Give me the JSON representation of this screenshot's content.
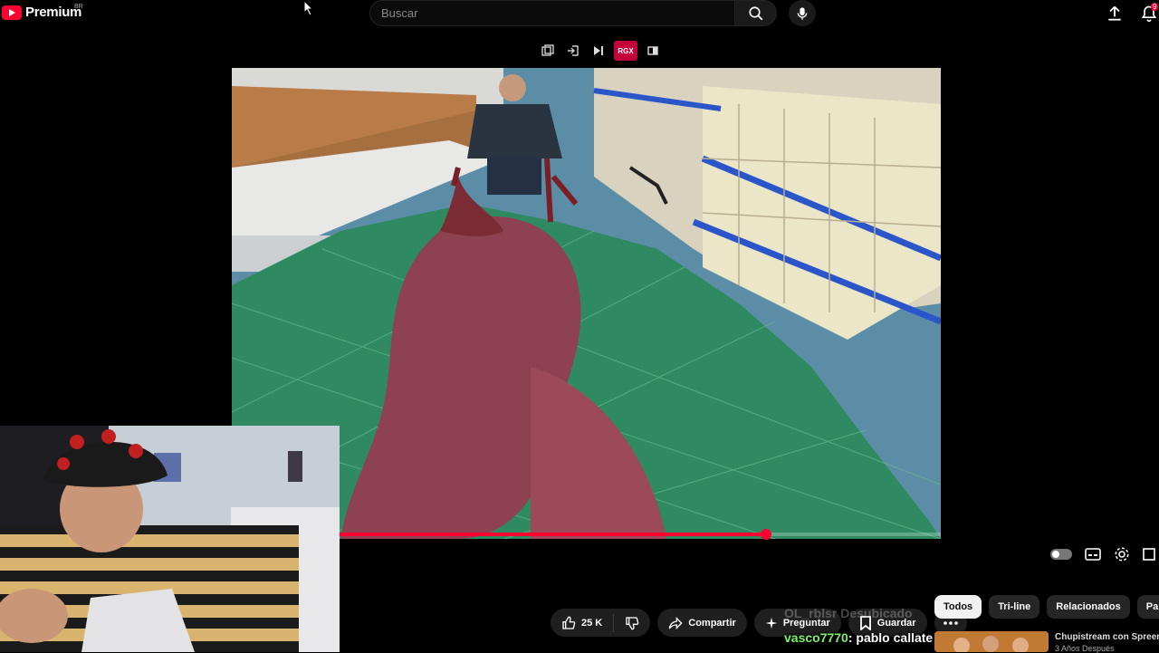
{
  "header": {
    "logo_text": "Premium",
    "region": "BR",
    "search_placeholder": "Buscar",
    "notification_count": "9"
  },
  "extension_toolbar": {
    "active_label": "RGX"
  },
  "player": {
    "progress_fraction": 0.71
  },
  "actions": {
    "like_count": "25 K",
    "share_label": "Compartir",
    "ask_label": "Preguntar",
    "save_label": "Guardar"
  },
  "chips": [
    "Todos",
    "Tri-line",
    "Relacionados",
    "Para ti"
  ],
  "chat": {
    "ghost_text": "OL_rblsr Desubicado",
    "username": "vasco7770",
    "message": ": pablo callate"
  },
  "recommendation": {
    "title": "Chupistream con Spreen",
    "subtitle": "3 Años Después"
  },
  "colors": {
    "accent": "#ff0033",
    "chat_user": "#7cf06a"
  }
}
